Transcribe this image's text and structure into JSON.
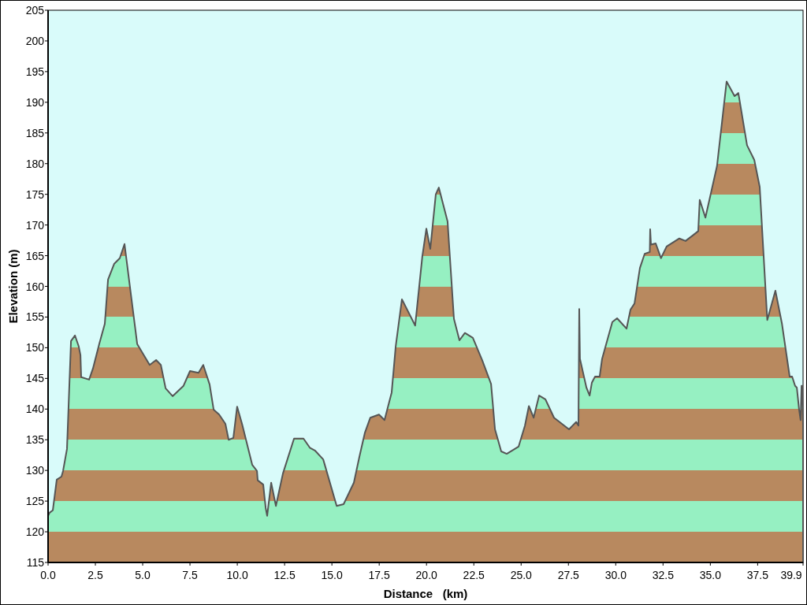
{
  "chart_data": {
    "type": "area",
    "xlabel": "Distance   (km)",
    "ylabel": "Elevation (m)",
    "x": [
      0,
      0.08,
      0.25,
      0.46,
      0.71,
      0.79,
      1.0,
      1.21,
      1.42,
      1.62,
      1.71,
      1.75,
      2.17,
      2.37,
      2.71,
      3.0,
      3.17,
      3.5,
      3.79,
      4.04,
      4.71,
      5.37,
      5.71,
      5.96,
      6.21,
      6.58,
      7.16,
      7.5,
      7.95,
      8.2,
      8.54,
      8.75,
      9.04,
      9.37,
      9.54,
      9.79,
      9.99,
      10.25,
      10.79,
      11.04,
      11.08,
      11.37,
      11.5,
      11.58,
      11.79,
      12.04,
      12.41,
      13.0,
      13.5,
      13.83,
      14.12,
      14.54,
      15.25,
      15.62,
      16.16,
      16.45,
      16.74,
      17.03,
      17.49,
      17.78,
      18.16,
      18.37,
      18.7,
      19.4,
      19.78,
      19.99,
      20.2,
      20.49,
      20.65,
      21.11,
      21.45,
      21.74,
      22.03,
      22.45,
      22.95,
      23.41,
      23.62,
      23.95,
      24.24,
      24.87,
      25.2,
      25.41,
      25.66,
      25.95,
      26.28,
      26.74,
      27.53,
      27.91,
      28.03,
      28.07,
      28.11,
      28.45,
      28.62,
      28.74,
      28.91,
      29.15,
      29.28,
      29.82,
      30.07,
      30.57,
      30.78,
      30.99,
      31.28,
      31.53,
      31.8,
      31.82,
      31.86,
      32.11,
      32.39,
      32.69,
      33.36,
      33.69,
      34.11,
      34.36,
      34.44,
      34.74,
      35.35,
      35.86,
      36.28,
      36.48,
      36.94,
      37.32,
      37.61,
      38.01,
      38.44,
      38.78,
      39.19,
      39.32,
      39.48,
      39.57,
      39.69,
      39.77,
      39.82,
      39.86,
      39.9
    ],
    "series": [
      {
        "color": "#555555",
        "values": [
          122.6,
          123.1,
          123.5,
          128.5,
          129,
          129.9,
          133.5,
          151.1,
          152,
          150.2,
          148.8,
          145.2,
          144.8,
          146.6,
          150.7,
          153.9,
          161.1,
          163.7,
          164.6,
          166.9,
          150.6,
          147.2,
          148,
          147.2,
          143.4,
          142.1,
          143.8,
          146.2,
          145.9,
          147.2,
          144,
          139.9,
          139.1,
          137.6,
          135,
          135.3,
          140.4,
          137.6,
          130.9,
          129.9,
          128.4,
          127.7,
          123.9,
          122.6,
          128,
          124.2,
          129.5,
          135.2,
          135.2,
          133.7,
          133.2,
          131.8,
          124.2,
          124.5,
          128,
          132.2,
          136.1,
          138.6,
          139.1,
          138.2,
          142.7,
          150.2,
          157.9,
          153.6,
          164.9,
          169.4,
          166.1,
          175,
          176.1,
          170.6,
          154.7,
          151.2,
          152.4,
          151.6,
          147.9,
          144.1,
          136.7,
          133.1,
          132.7,
          133.9,
          137.3,
          140.5,
          138.6,
          142.2,
          141.6,
          138.6,
          136.7,
          137.9,
          137.3,
          156.3,
          148.2,
          143.5,
          142.2,
          144.3,
          145.3,
          145.3,
          148.2,
          154.2,
          154.8,
          153.1,
          156.2,
          157.2,
          163,
          165.3,
          165.6,
          169.3,
          166.8,
          167,
          164.6,
          166.5,
          167.8,
          167.4,
          168.4,
          169,
          174.1,
          171.2,
          179.6,
          193.4,
          191,
          191.5,
          183,
          180.6,
          176.2,
          154.5,
          159.3,
          154,
          145.3,
          145.3,
          143.8,
          143.5,
          139.9,
          138.2,
          143.8,
          143.8,
          137.3
        ]
      }
    ],
    "xlim": [
      0,
      39.9
    ],
    "ylim": [
      115,
      205
    ],
    "xticks": [
      {
        "value": 0,
        "label": "0.0"
      },
      {
        "value": 2.5,
        "label": "2.5"
      },
      {
        "value": 5,
        "label": "5.0"
      },
      {
        "value": 7.5,
        "label": "7.5"
      },
      {
        "value": 10,
        "label": "10.0"
      },
      {
        "value": 12.5,
        "label": "12.5"
      },
      {
        "value": 15,
        "label": "15.0"
      },
      {
        "value": 17.5,
        "label": "17.5"
      },
      {
        "value": 20,
        "label": "20.0"
      },
      {
        "value": 22.5,
        "label": "22.5"
      },
      {
        "value": 25,
        "label": "25.0"
      },
      {
        "value": 27.5,
        "label": "27.5"
      },
      {
        "value": 30,
        "label": "30.0"
      },
      {
        "value": 32.5,
        "label": "32.5"
      },
      {
        "value": 35,
        "label": "35.0"
      },
      {
        "value": 37.5,
        "label": "37.5"
      },
      {
        "value": 39.9,
        "label": "39.9"
      }
    ],
    "yticks": [
      115,
      120,
      125,
      130,
      135,
      140,
      145,
      150,
      155,
      160,
      165,
      170,
      175,
      180,
      185,
      190,
      195,
      200,
      205
    ]
  }
}
